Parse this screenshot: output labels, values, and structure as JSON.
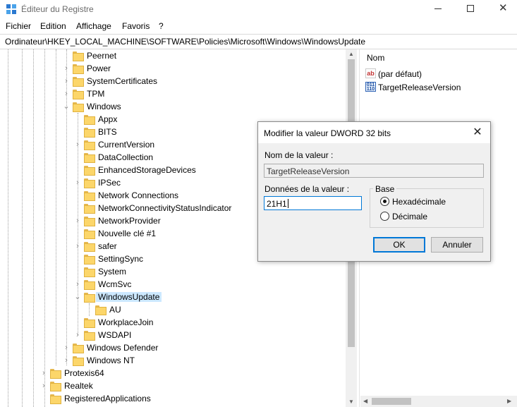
{
  "window": {
    "title": "Éditeur du Registre"
  },
  "menu": [
    "Fichier",
    "Edition",
    "Affichage",
    "Favoris",
    "?"
  ],
  "address": "Ordinateur\\HKEY_LOCAL_MACHINE\\SOFTWARE\\Policies\\Microsoft\\Windows\\WindowsUpdate",
  "tree": [
    "Peernet",
    "Power",
    "SystemCertificates",
    "TPM",
    "Windows",
    "Appx",
    "BITS",
    "CurrentVersion",
    "DataCollection",
    "EnhancedStorageDevices",
    "IPSec",
    "Network Connections",
    "NetworkConnectivityStatusIndicator",
    "NetworkProvider",
    "Nouvelle clé #1",
    "safer",
    "SettingSync",
    "System",
    "WcmSvc",
    "WindowsUpdate",
    "AU",
    "WorkplaceJoin",
    "WSDAPI",
    "Windows Defender",
    "Windows NT",
    "Protexis64",
    "Realtek",
    "RegisteredApplications"
  ],
  "values_pane": {
    "column_header": "Nom",
    "rows": [
      {
        "name": "(par défaut)",
        "icon": "reg-string-icon"
      },
      {
        "name": "TargetReleaseVersion",
        "icon": "reg-binary-icon"
      }
    ]
  },
  "dialog": {
    "title": "Modifier la valeur DWORD 32 bits",
    "value_name_label": "Nom de la valeur :",
    "value_name": "TargetReleaseVersion",
    "value_data_label": "Données de la valeur :",
    "value_data": "21H1",
    "base_label": "Base",
    "base_options": [
      {
        "label": "Hexadécimale",
        "selected": true
      },
      {
        "label": "Décimale",
        "selected": false
      }
    ],
    "ok_label": "OK",
    "cancel_label": "Annuler"
  }
}
